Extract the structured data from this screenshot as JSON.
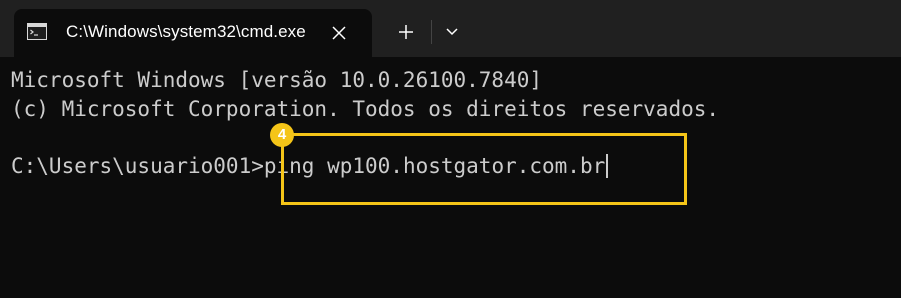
{
  "window": {
    "tab": {
      "title": "C:\\Windows\\system32\\cmd.exe",
      "icon": "cmd-icon",
      "close_icon": "close-icon"
    },
    "new_tab_icon": "plus-icon",
    "dropdown_icon": "chevron-down-icon"
  },
  "console": {
    "lines": [
      "Microsoft Windows [versão 10.0.26100.7840]",
      "(c) Microsoft Corporation. Todos os direitos reservados."
    ],
    "prompt": "C:\\Users\\usuario001>",
    "command": "ping wp100.hostgator.com.br"
  },
  "annotation": {
    "step": "4",
    "color": "#f5c518"
  },
  "colors": {
    "titlebar": "#202020",
    "background": "#0c0c0c",
    "text": "#cccccc"
  }
}
